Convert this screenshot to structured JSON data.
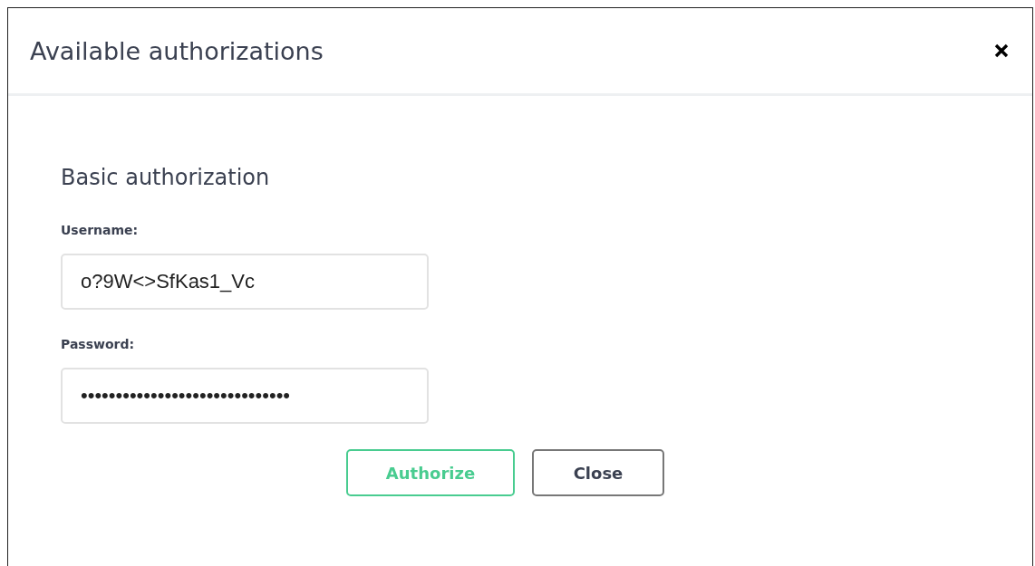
{
  "dialog": {
    "title": "Available authorizations"
  },
  "section": {
    "title": "Basic authorization"
  },
  "fields": [
    {
      "label": "Username:",
      "value": "o?9W<>SfKas1_Vc"
    },
    {
      "label": "Password:",
      "value": "••••••••••••••••••••••••••••••"
    }
  ],
  "buttons": [
    {
      "label": "Authorize",
      "kind": "primary"
    },
    {
      "label": "Close",
      "kind": "secondary"
    }
  ]
}
